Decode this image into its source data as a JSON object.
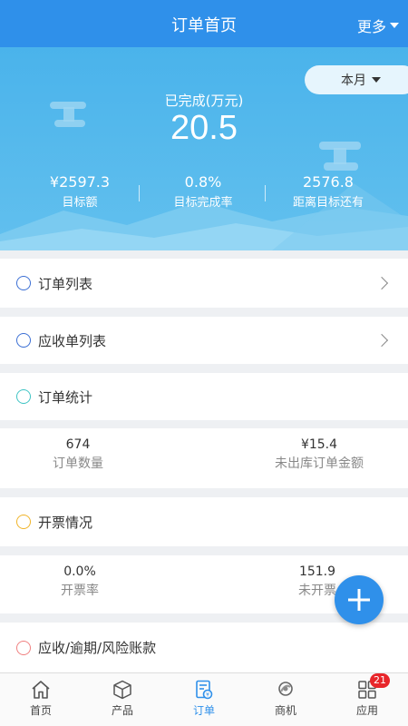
{
  "header": {
    "title": "订单首页",
    "more_label": "更多"
  },
  "hero": {
    "period": "本月",
    "completed_label": "已完成(万元)",
    "completed_value": "20.5",
    "stats": [
      {
        "value": "¥2597.3",
        "label": "目标额"
      },
      {
        "value": "0.8%",
        "label": "目标完成率"
      },
      {
        "value": "2576.8",
        "label": "距离目标还有"
      }
    ]
  },
  "sections": {
    "order_list": {
      "label": "订单列表",
      "color": "#3b6fd4"
    },
    "receivable_list": {
      "label": "应收单列表",
      "color": "#3b6fd4"
    },
    "order_stats": {
      "label": "订单统计",
      "color": "#3fc4c4",
      "metrics": [
        {
          "value": "674",
          "label": "订单数量"
        },
        {
          "value": "¥15.4",
          "label": "未出库订单金额"
        }
      ]
    },
    "invoice": {
      "label": "开票情况",
      "color": "#f0b429",
      "metrics": [
        {
          "value": "0.0%",
          "label": "开票率"
        },
        {
          "value": "151.9",
          "label": "未开票"
        }
      ]
    },
    "receivable_overdue": {
      "label": "应收/逾期/风险账款",
      "color": "#f08080"
    }
  },
  "tabbar": {
    "items": [
      {
        "label": "首页",
        "icon": "home-icon"
      },
      {
        "label": "产品",
        "icon": "box-icon"
      },
      {
        "label": "订单",
        "icon": "order-icon"
      },
      {
        "label": "商机",
        "icon": "opportunity-icon"
      },
      {
        "label": "应用",
        "icon": "apps-icon",
        "badge": "21"
      }
    ],
    "active": "订单"
  },
  "colors": {
    "primary": "#2f90ea",
    "badge": "#e8262b"
  }
}
